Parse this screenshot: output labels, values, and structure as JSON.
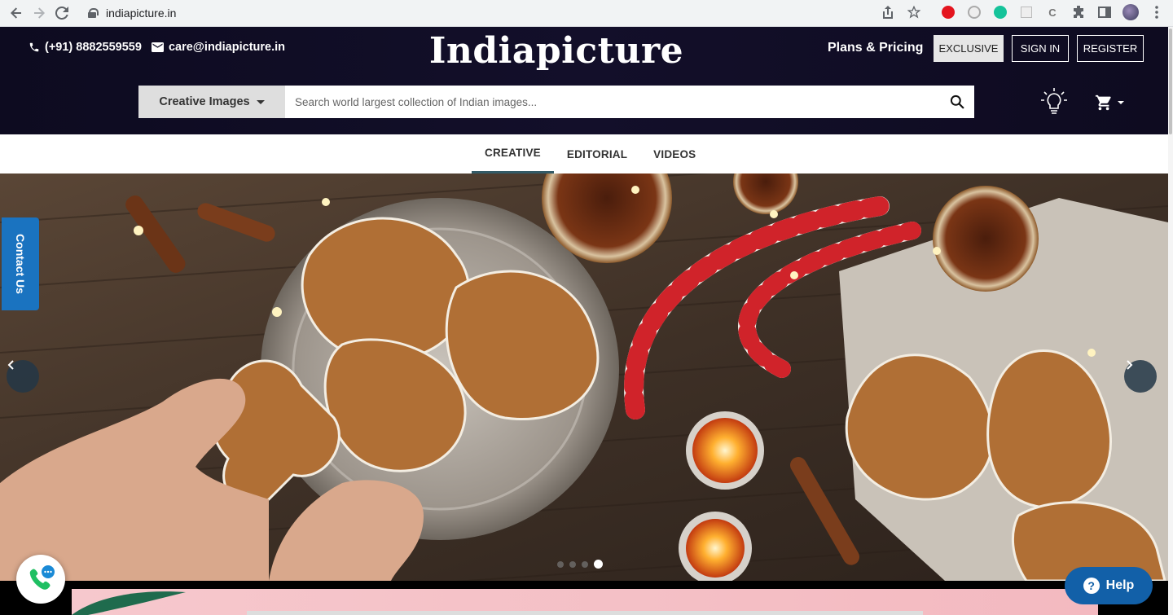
{
  "browser": {
    "url": "indiapicture.in",
    "back_icon": "arrow-left-icon",
    "forward_icon": "arrow-right-icon",
    "reload_icon": "reload-icon"
  },
  "header": {
    "phone": "(+91) 8882559559",
    "email": "care@indiapicture.in",
    "logo": "Indiapicture",
    "plans_label": "Plans & Pricing",
    "exclusive_label": "EXCLUSIVE",
    "signin_label": "SIGN IN",
    "register_label": "REGISTER"
  },
  "search": {
    "category": "Creative Images",
    "placeholder": "Search world largest collection of Indian images..."
  },
  "tabs": [
    {
      "label": "CREATIVE",
      "active": true
    },
    {
      "label": "EDITORIAL",
      "active": false
    },
    {
      "label": "VIDEOS",
      "active": false
    }
  ],
  "hero": {
    "slide_count": 4,
    "active_slide": 4
  },
  "widgets": {
    "contact_us": "Contact Us",
    "help_label": "Help",
    "help_symbol": "?"
  },
  "colors": {
    "header_bg": "#0d0b20",
    "tab_active": "#335a66",
    "contact_blue": "#1a73c0",
    "help_blue": "#1260a8",
    "call_green": "#1fbf62"
  }
}
